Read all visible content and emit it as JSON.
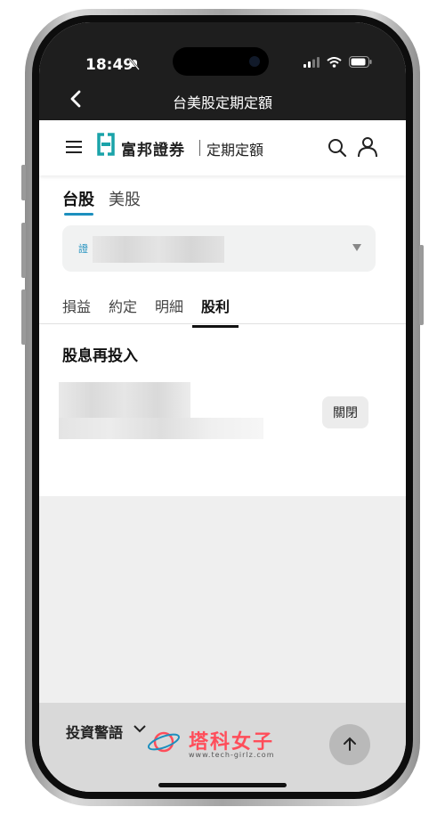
{
  "status_bar": {
    "time": "18:49"
  },
  "nav": {
    "title": "台美股定期定額"
  },
  "app_header": {
    "brand": "富邦證券",
    "subbrand": "定期定額"
  },
  "market_tabs": [
    {
      "label": "台股",
      "active": true
    },
    {
      "label": "美股",
      "active": false
    }
  ],
  "account": {
    "label": "證"
  },
  "sub_tabs": [
    {
      "label": "損益",
      "active": false
    },
    {
      "label": "約定",
      "active": false
    },
    {
      "label": "明細",
      "active": false
    },
    {
      "label": "股利",
      "active": true
    }
  ],
  "section": {
    "title": "股息再投入",
    "button": "關閉"
  },
  "footer": {
    "label": "投資警語"
  },
  "watermark": {
    "text": "塔科女子",
    "url": "www.tech-girlz.com"
  },
  "colors": {
    "accent": "#1c8fbe",
    "topbar": "#1e1e1e",
    "watermark": "#ff4d5a"
  }
}
